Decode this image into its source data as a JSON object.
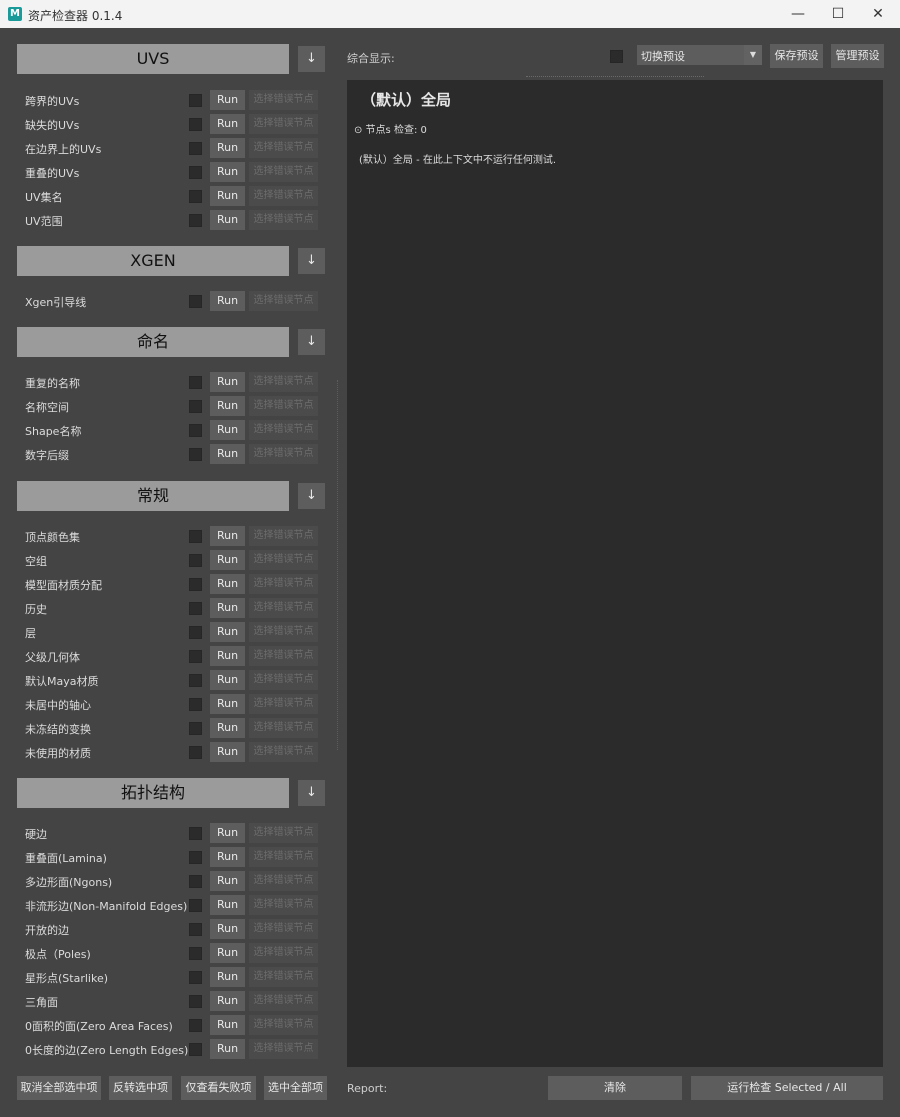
{
  "window": {
    "title": "资产检查器 0.1.4",
    "logo_letter": "M",
    "minimize": "—",
    "maximize": "☐",
    "close": "✕"
  },
  "run_label": "Run",
  "select_error_label": "选择错误节点",
  "arrow_label": "↓",
  "sections": [
    {
      "title": "UVS",
      "items": [
        "跨界的UVs",
        "缺失的UVs",
        "在边界上的UVs",
        "重叠的UVs",
        "UV集名",
        "UV范围"
      ]
    },
    {
      "title": "XGEN",
      "items": [
        "Xgen引导线"
      ]
    },
    {
      "title": "命名",
      "items": [
        "重复的名称",
        "名称空间",
        "Shape名称",
        "数字后缀"
      ]
    },
    {
      "title": "常规",
      "items": [
        "顶点颜色集",
        "空组",
        "模型面材质分配",
        "历史",
        "层",
        "父级几何体",
        "默认Maya材质",
        "未居中的轴心",
        "未冻结的变换",
        "未使用的材质"
      ]
    },
    {
      "title": "拓扑结构",
      "items": [
        "硬边",
        "重叠面(Lamina)",
        "多边形面(Ngons)",
        "非流形边(Non-Manifold Edges)",
        "开放的边",
        "极点（Poles)",
        "星形点(Starlike)",
        "三角面",
        "0面积的面(Zero Area Faces)",
        "0长度的边(Zero Length Edges)"
      ]
    }
  ],
  "bottom_left_buttons": [
    "取消全部选中项",
    "反转选中项",
    "仅查看失败项",
    "选中全部项"
  ],
  "right": {
    "summary_label": "综合显示:",
    "preset_combo": "切换预设",
    "save_preset": "保存预设",
    "manage_preset": "管理预设",
    "panel_title": "（默认）全局",
    "panel_stats": "⊙ 节点s 检查: 0",
    "panel_desc": "(默认）全局 - 在此上下文中不运行任何测试.",
    "report_label": "Report:",
    "clear_button": "清除",
    "run_button": "运行检查 Selected / All"
  }
}
